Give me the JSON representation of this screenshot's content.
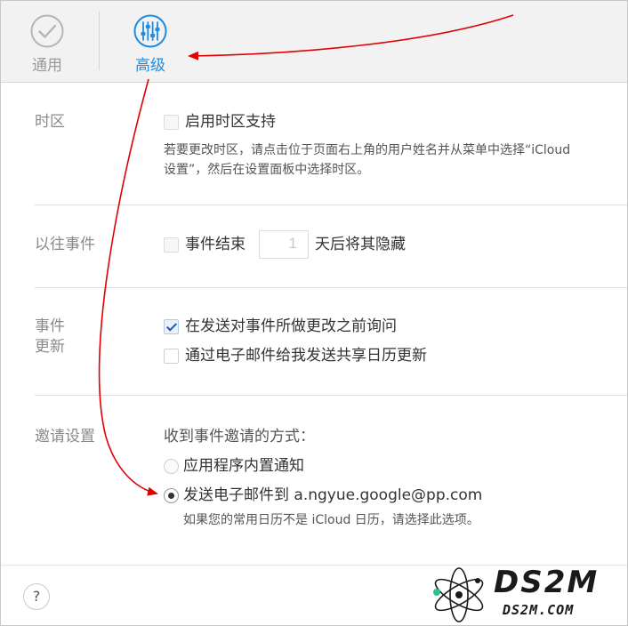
{
  "tabs": {
    "general": "通用",
    "advanced": "高级"
  },
  "timezone": {
    "label": "时区",
    "option": "启用时区支持",
    "help_line1": "若要更改时区，请点击位于页面右上角的用户姓名并从菜单中选择“iCloud",
    "help_line2": "设置”，然后在设置面板中选择时区。"
  },
  "past_events": {
    "label": "以往事件",
    "option_before": "事件结束",
    "days_value": "1",
    "option_after": "天后将其隐藏"
  },
  "event_updates": {
    "label_line1": "事件",
    "label_line2": "更新",
    "option1": "在发送对事件所做更改之前询问",
    "option1_checked": true,
    "option2": "通过电子邮件给我发送共享日历更新",
    "option2_checked": false
  },
  "invitations": {
    "label": "邀请设置",
    "heading": "收到事件邀请的方式：",
    "option1": "应用程序内置通知",
    "option2": "发送电子邮件到 a.ngyue.google@pp.com",
    "selected": "option2",
    "help": "如果您的常用日历不是 iCloud 日历，请选择此选项。"
  },
  "footer": {
    "help_button": "?"
  },
  "watermark": {
    "logo": "DS2M",
    "url": "DS2M.COM"
  },
  "colors": {
    "accent": "#1b8ce3",
    "annotation_arrow": "#e00000"
  },
  "icons": {
    "general": "checkmark-circle-icon",
    "advanced": "sliders-icon"
  }
}
